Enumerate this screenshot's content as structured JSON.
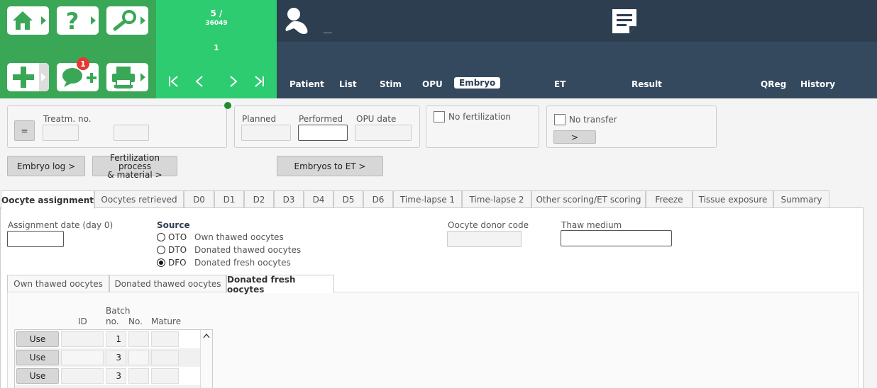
{
  "header": {
    "counter_main": "5 /",
    "counter_total": "36049",
    "counter_sub": "1",
    "notification_count": "1",
    "nav_first": "|<",
    "nav_prev": "<",
    "nav_next": ">",
    "nav_last": ">|",
    "tabs": [
      "Patient",
      "List",
      "Stim",
      "OPU",
      "Embryo",
      "ET",
      "Result",
      "QReg",
      "History"
    ],
    "active_tab": "Embryo"
  },
  "top_panel": {
    "equals_btn": "=",
    "treatm_label": "Treatm. no.",
    "planned_label": "Planned",
    "performed_label": "Performed",
    "opu_date_label": "OPU date",
    "no_fertilization_label": "No fertilization",
    "no_transfer_label": "No transfer",
    "no_transfer_btn": ">",
    "embryo_log_btn": "Embryo log >",
    "fert_btn_line1": "Fertilization process",
    "fert_btn_line2": "& material >",
    "embryos_to_et_btn": "Embryos to ET >"
  },
  "tabs": [
    "Oocyte assignment",
    "Oocytes retrieved",
    "D0",
    "D1",
    "D2",
    "D3",
    "D4",
    "D5",
    "D6",
    "Time-lapse 1",
    "Time-lapse 2",
    "Other scoring/ET scoring",
    "Freeze",
    "Tissue exposure",
    "Summary"
  ],
  "active_tab": "Oocyte assignment",
  "assignment": {
    "date_label": "Assignment date (day 0)",
    "source_label": "Source",
    "sources": [
      {
        "code": "OTO",
        "desc": "Own thawed oocytes",
        "selected": false
      },
      {
        "code": "DTO",
        "desc": "Donated thawed oocytes",
        "selected": false
      },
      {
        "code": "DFO",
        "desc": "Donated fresh oocytes",
        "selected": true
      }
    ],
    "donor_code_label": "Oocyte donor code",
    "thaw_medium_label": "Thaw medium"
  },
  "subtabs": [
    "Own thawed oocytes",
    "Donated thawed oocytes",
    "Donated fresh oocytes"
  ],
  "active_subtab": "Donated fresh oocytes",
  "table": {
    "headers": {
      "id": "ID",
      "batch_line1": "Batch",
      "batch_line2": "no.",
      "no": "No.",
      "mature": "Mature"
    },
    "use_label": "Use",
    "scroll_up": "^",
    "rows": [
      {
        "batch": "1"
      },
      {
        "batch": "3"
      },
      {
        "batch": "3"
      }
    ]
  },
  "colors": {
    "green": "#3aa757",
    "green_light": "#2ecc71",
    "dark": "#2c3e50",
    "dark2": "#34495e",
    "status_dot": "#1e8c2e"
  }
}
